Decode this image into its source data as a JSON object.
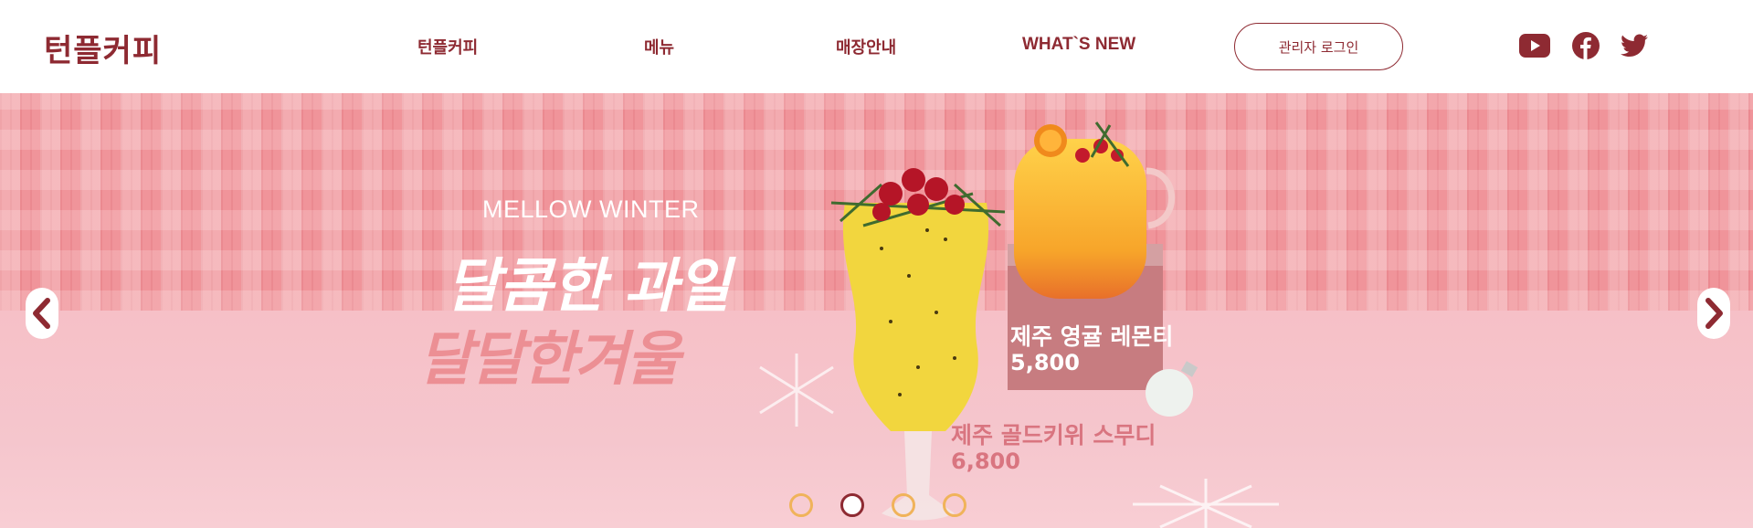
{
  "header": {
    "logo": "턴플커피",
    "nav": [
      "턴플커피",
      "메뉴",
      "매장안내",
      "WHAT`S NEW"
    ],
    "login_label": "관리자 로그인",
    "social_icons": [
      "youtube-icon",
      "facebook-icon",
      "twitter-icon"
    ]
  },
  "hero": {
    "kicker": "MELLOW WINTER",
    "line1": "달콤한 과일",
    "line2": "달달한겨울",
    "products": [
      {
        "name": "제주 영귤 레몬티",
        "price": "5,800"
      },
      {
        "name": "제주 골드키위 스무디",
        "price": "6,800"
      }
    ],
    "slides_total": 4,
    "active_slide": 2
  },
  "colors": {
    "brand": "#8e2a32",
    "dot_inactive": "#f0b35a",
    "plaid": "#f0949a",
    "floor": "#f6c0c7"
  }
}
